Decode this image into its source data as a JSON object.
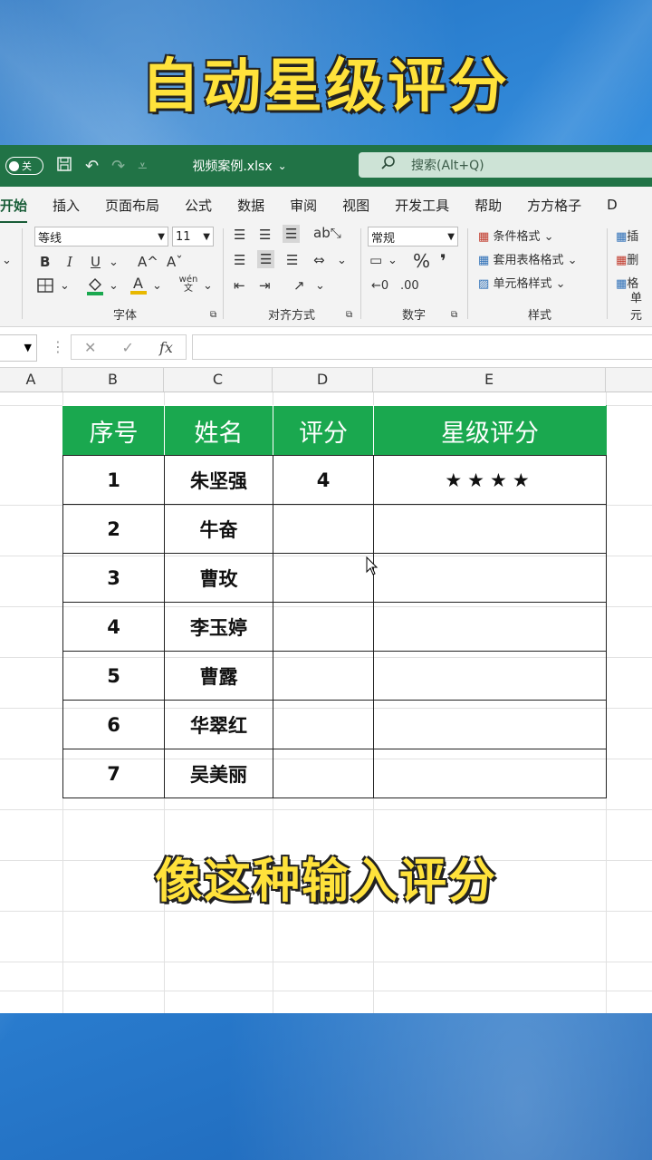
{
  "video": {
    "title": "自动星级评分",
    "subtitle": "像这种输入评分"
  },
  "titlebar": {
    "autosave_label": "关",
    "filename": "视频案例.xlsx",
    "filename_dropdown": "⌄",
    "search_placeholder": "搜索(Alt+Q)"
  },
  "ribbon_tabs": [
    "开始",
    "插入",
    "页面布局",
    "公式",
    "数据",
    "审阅",
    "视图",
    "开发工具",
    "帮助",
    "方方格子",
    "D"
  ],
  "font_group": {
    "font_name": "等线",
    "font_size": "11",
    "bold": "B",
    "italic": "I",
    "underline": "U",
    "grow": "A^",
    "shrink": "Aˇ",
    "wen": "wén 文",
    "label": "字体"
  },
  "align_group": {
    "label": "对齐方式"
  },
  "number_group": {
    "format": "常规",
    "percent": "%",
    "comma": "❜",
    "label": "数字"
  },
  "styles_group": {
    "conditional": "条件格式",
    "table": "套用表格格式",
    "cell": "单元格样式",
    "label": "样式"
  },
  "cells_group": {
    "insert": "插",
    "delete": "删",
    "format": "格",
    "label": "单元"
  },
  "formula_bar": {
    "cancel": "✕",
    "enter": "✓",
    "fx": "fx"
  },
  "columns": [
    "A",
    "B",
    "C",
    "D",
    "E"
  ],
  "table": {
    "headers": [
      "序号",
      "姓名",
      "评分",
      "星级评分"
    ],
    "rows": [
      {
        "no": "1",
        "name": "朱坚强",
        "score": "4",
        "stars": "★★★★"
      },
      {
        "no": "2",
        "name": "牛奋",
        "score": "",
        "stars": ""
      },
      {
        "no": "3",
        "name": "曹玫",
        "score": "",
        "stars": ""
      },
      {
        "no": "4",
        "name": "李玉婷",
        "score": "",
        "stars": ""
      },
      {
        "no": "5",
        "name": "曹露",
        "score": "",
        "stars": ""
      },
      {
        "no": "6",
        "name": "华翠红",
        "score": "",
        "stars": ""
      },
      {
        "no": "7",
        "name": "吴美丽",
        "score": "",
        "stars": ""
      }
    ]
  }
}
